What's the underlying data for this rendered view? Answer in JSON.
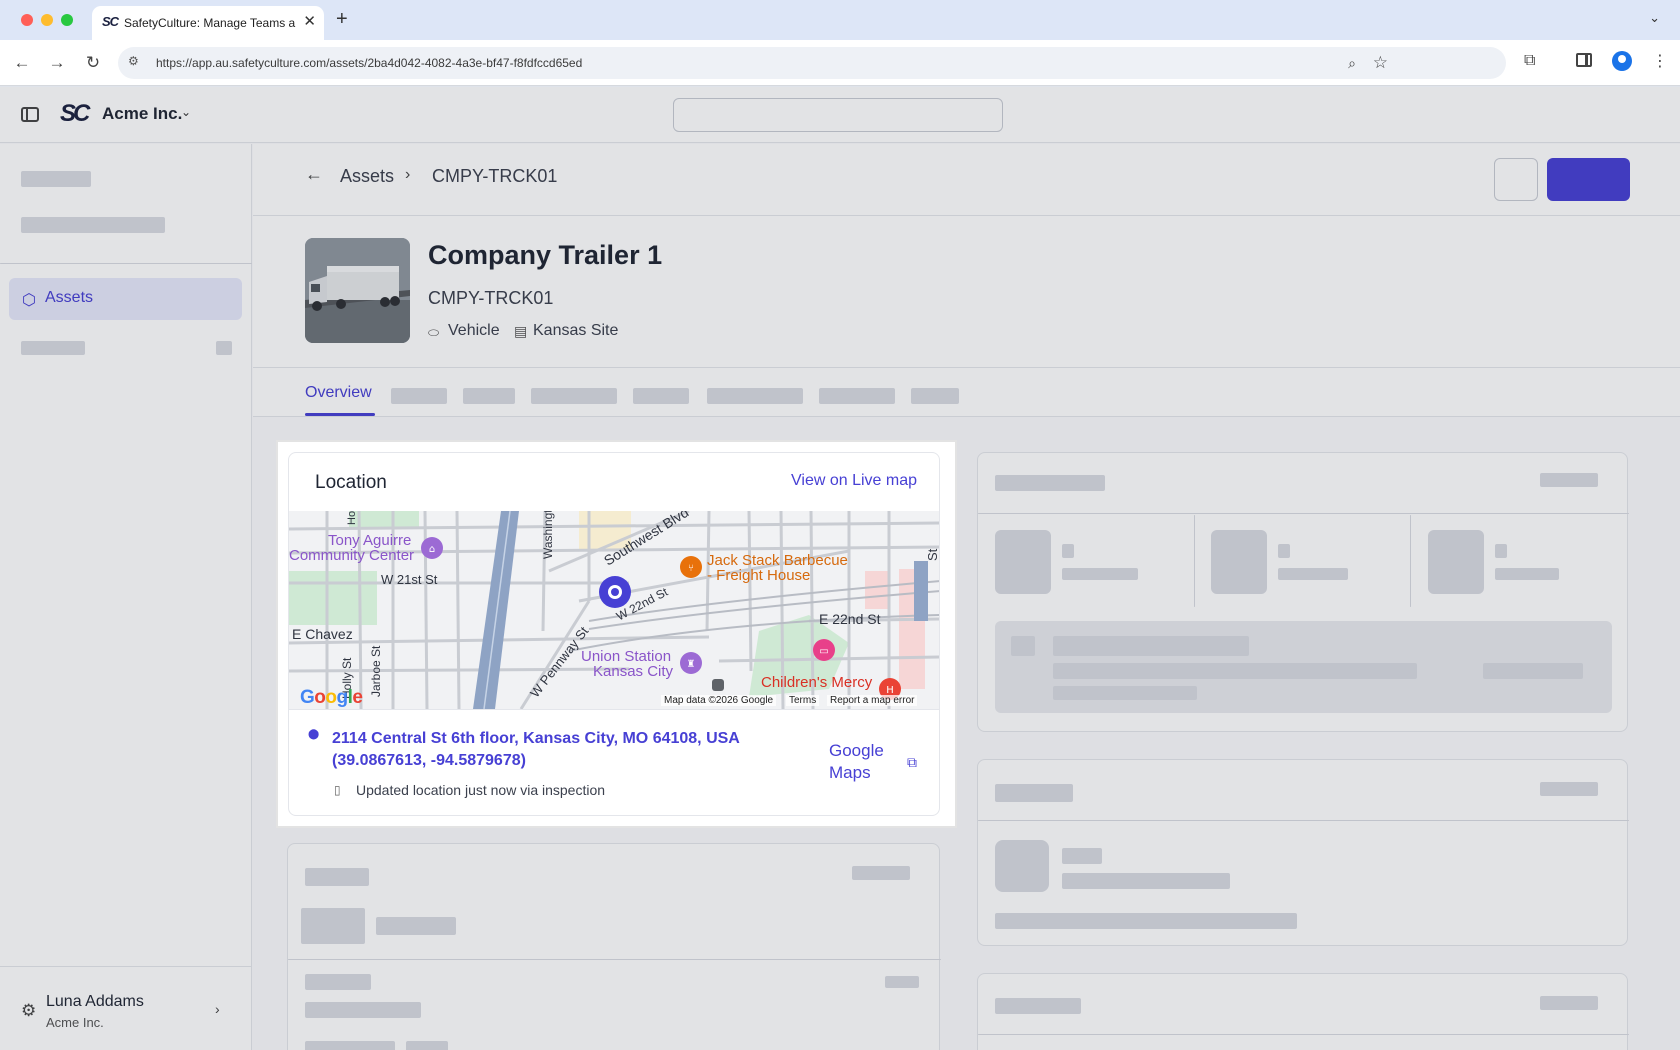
{
  "browser": {
    "tab_title": "SafetyCulture: Manage Teams and...",
    "tab_favicon_text": "SC",
    "url": "https://app.au.safetyculture.com/assets/2ba4d042-4082-4a3e-bf47-f8fdfccd65ed"
  },
  "app": {
    "logo_text": "SC",
    "org_name": "Acme Inc.",
    "sidebar": {
      "active_item": "Assets"
    },
    "user": {
      "name": "Luna Addams",
      "org": "Acme Inc."
    }
  },
  "page": {
    "breadcrumb": {
      "parent": "Assets",
      "current": "CMPY-TRCK01"
    },
    "asset": {
      "title": "Company Trailer 1",
      "code": "CMPY-TRCK01",
      "type": "Vehicle",
      "site": "Kansas Site"
    },
    "tabs": {
      "active": "Overview"
    }
  },
  "location_card": {
    "title": "Location",
    "live_map_link": "View on Live map",
    "map": {
      "labels": {
        "tony": "Tony Aguirre",
        "community": "Community Center",
        "holly_top": "Hol",
        "w21": "W 21st St",
        "washington": "Washington",
        "southwest": "Southwest Blvd",
        "jack1": "Jack Stack Barbecue",
        "jack2": "- Freight House",
        "st_right": "St",
        "w22": "W 22nd St",
        "e22": "E 22nd St",
        "echavez": "E Chavez",
        "holly": "Holly St",
        "jarboe": "Jarboe St",
        "pennway": "W Pennway St",
        "union1": "Union Station",
        "union2": "Kansas City",
        "childrens": "Children's Mercy"
      },
      "google_logo": "Google",
      "attribution": "Map data ©2026 Google",
      "terms": "Terms",
      "report": "Report a map error"
    },
    "address": "2114 Central St 6th floor, Kansas City, MO 64108, USA",
    "coordinates": "(39.0867613, -94.5879678)",
    "update_note": "Updated location just now via inspection",
    "google_maps_line1": "Google",
    "google_maps_line2": "Maps"
  },
  "colors": {
    "accent": "#4740d4",
    "poi_orange": "#e8710a",
    "poi_purple": "#9c6ad4",
    "poi_pink": "#e8408a",
    "poi_red": "#ea4335"
  }
}
